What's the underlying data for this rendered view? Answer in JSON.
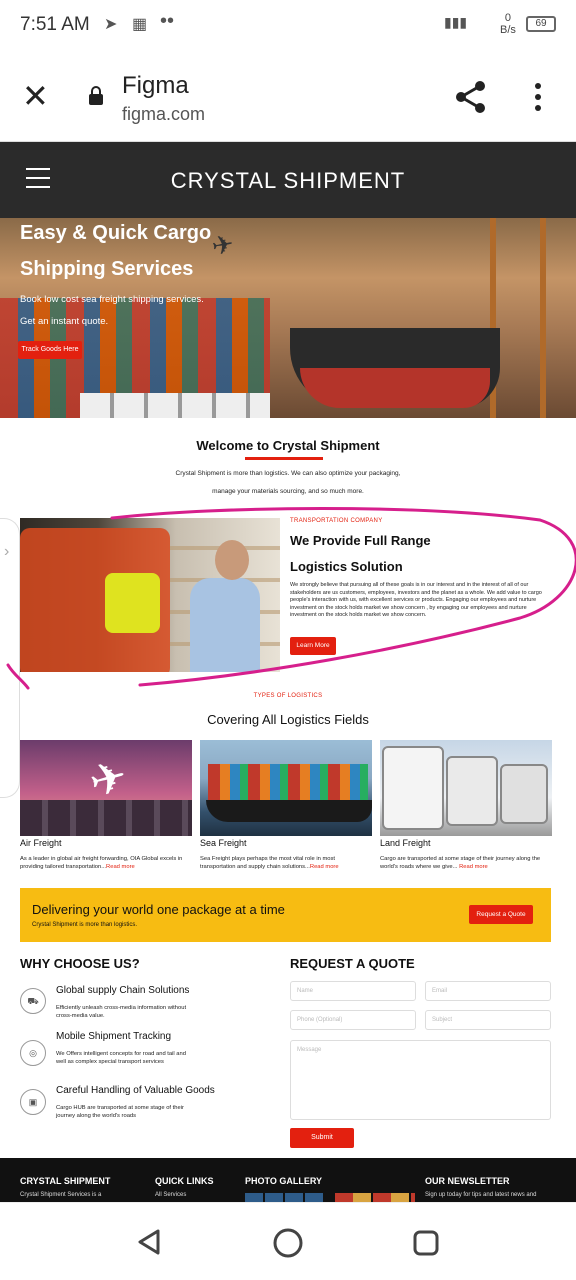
{
  "status_bar": {
    "time": "7:51 AM",
    "net_speed_value": "0",
    "net_speed_unit": "B/s",
    "battery": "69"
  },
  "browser": {
    "title": "Figma",
    "url": "figma.com"
  },
  "site": {
    "brand": "CRYSTAL SHIPMENT"
  },
  "hero": {
    "title_line1": "Easy & Quick Cargo",
    "title_line2": "Shipping Services",
    "sub1": "Book low cost sea freight shipping services.",
    "sub2": "Get an instant quote.",
    "button": "Track Goods Here"
  },
  "welcome": {
    "title": "Welcome to Crystal Shipment",
    "text1": "Crystal Shipment is more than logistics. We can also optimize your packaging,",
    "text2": "manage your materials sourcing, and so much more."
  },
  "provide": {
    "kicker": "TRANSPORTATION COMPANY",
    "title1": "We Provide Full Range",
    "title2": "Logistics Solution",
    "body": "We strongly believe that pursuing all of these goals is in our interest and in the interest of all of our stakeholders are us customers, employees, investors and the planet as a whole. We add value to cargo people's interaction with us, with excellent services or products. Engaging our employees and nurture investment on the stock holds market we show concern , by engaging our employees and nurture investment on the stock holds market we show concern.",
    "button": "Learn More"
  },
  "logistics": {
    "kicker": "TYPES OF LOGISTICS",
    "title": "Covering All Logistics Fields",
    "cards": [
      {
        "title": "Air Freight",
        "text": "As a leader in global air freight forwarding, OIA Global excels in providing tailored transportation...",
        "more": "Read more"
      },
      {
        "title": "Sea Freight",
        "text": "Sea Freight plays perhaps the most vital role in most transportation and supply chain solutions...",
        "more": "Read more"
      },
      {
        "title": "Land Freight",
        "text": "Cargo are transported at some stage of their journey along the world's roads where we give...",
        "more": "Read more"
      }
    ]
  },
  "banner": {
    "title": "Delivering your world one package at a time",
    "sub": "Crystal Shipment is more than logistics.",
    "button": "Request a Quote"
  },
  "why": {
    "title": "WHY CHOOSE US?",
    "items": [
      {
        "title": "Global supply Chain Solutions",
        "text": "Efficiently unleash cross-media information without cross-media value.",
        "icon": "truck-icon"
      },
      {
        "title": "Mobile Shipment Tracking",
        "text": "We Offers intelligent concepts for road and tail and well as complex special transport services",
        "icon": "location-icon"
      },
      {
        "title": "Careful Handling of Valuable Goods",
        "text": "Cargo HUB are transported at some stage of their journey along the world's roads",
        "icon": "box-icon"
      }
    ]
  },
  "quote": {
    "title": "REQUEST A QUOTE",
    "name": "Name",
    "email": "Email",
    "phone": "Phone (Optional)",
    "subject": "Subject",
    "message": "Message",
    "submit": "Submit"
  },
  "footer": {
    "col1_title": "CRYSTAL SHIPMENT",
    "col1_text": "Crystal Shipment Services is a",
    "col2_title": "QUICK LINKS",
    "col2_text": "All Services",
    "col3_title": "PHOTO GALLERY",
    "col4_title": "OUR NEWSLETTER",
    "col4_text": "Sign up today for tips and latest news and"
  },
  "colors": {
    "accent": "#e3200f",
    "banner": "#f7bc12",
    "header": "#2b2b2b",
    "annotation": "#d61f8c"
  }
}
